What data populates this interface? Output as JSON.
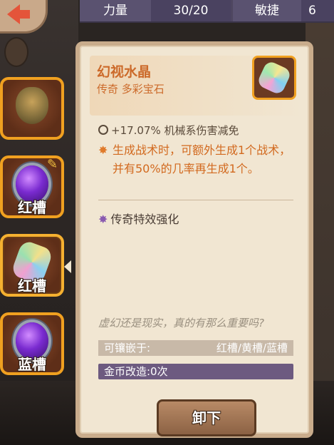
{
  "stats": {
    "strength_label": "力量",
    "strength_value": "30/20",
    "agility_label": "敏捷",
    "agility_value": "6"
  },
  "slots": [
    {
      "label": "",
      "icon": "shield-icon"
    },
    {
      "label": "红槽",
      "icon": "purple-gem-icon"
    },
    {
      "label": "红槽",
      "icon": "crystal-gem-icon"
    },
    {
      "label": "蓝槽",
      "icon": "purple-gem-icon"
    }
  ],
  "item": {
    "name": "幻视水晶",
    "subtitle": "传奇 多彩宝石",
    "stat": "+17.07% 机械系伤害减免",
    "effect": "生成战术时，可额外生成1个战术，并有50%的几率再生成1个。",
    "legend_title": "传奇特效强化",
    "flavor": "虚幻还是现实，真的有那么重要吗?",
    "socket_label": "可镶嵌于:",
    "socket_value": "红槽/黄槽/蓝槽",
    "reforge": "金币改造:0次"
  },
  "buttons": {
    "unequip": "卸下"
  },
  "colors": {
    "accent_orange": "#cc6a2a",
    "slot_border": "#f0a020",
    "stat_bar": "#4e4660",
    "reforge_bar": "#6d5a80"
  }
}
